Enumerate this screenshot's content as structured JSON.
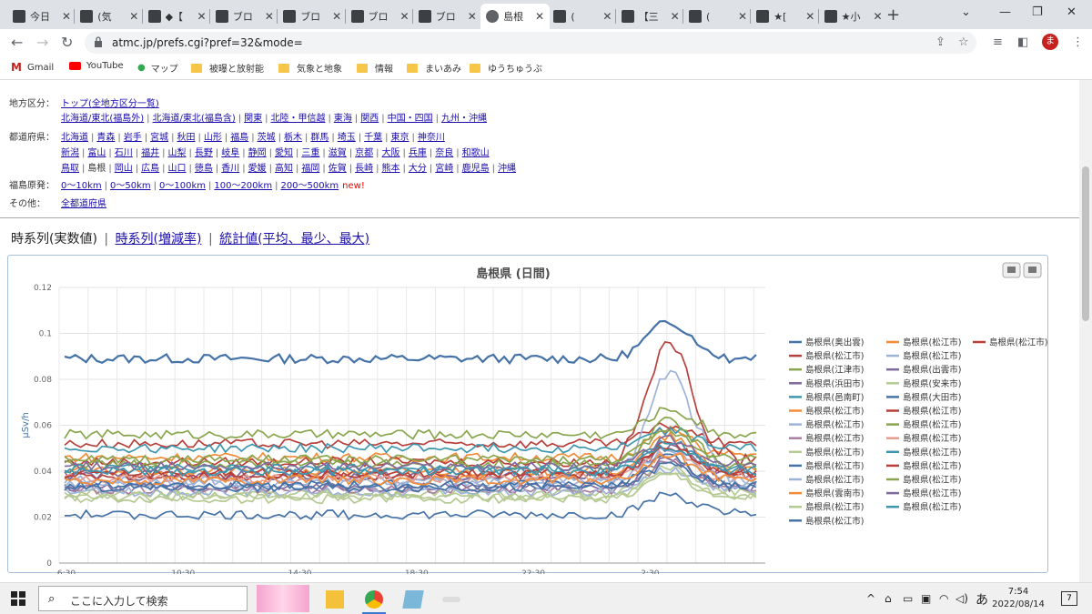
{
  "tabs": [
    {
      "title": "今日",
      "active": false
    },
    {
      "title": "(気",
      "active": false
    },
    {
      "title": "◆【",
      "active": false
    },
    {
      "title": "ブロ",
      "active": false
    },
    {
      "title": "ブロ",
      "active": false
    },
    {
      "title": "ブロ",
      "active": false
    },
    {
      "title": "ブロ",
      "active": false
    },
    {
      "title": "島根",
      "active": true
    },
    {
      "title": "(",
      "active": false
    },
    {
      "title": "【三",
      "active": false
    },
    {
      "title": "(",
      "active": false
    },
    {
      "title": "★[",
      "active": false
    },
    {
      "title": "★小",
      "active": false
    }
  ],
  "toolbar": {
    "url": "atmc.jp/prefs.cgi?pref=32&mode=",
    "avatar": "ま"
  },
  "bookmarks": [
    "Gmail",
    "YouTube",
    "マップ",
    "被曝と放射能",
    "気象と地象",
    "情報",
    "まいあみ",
    "ゆうちゅうぶ"
  ],
  "nav": {
    "region_label": "地方区分：",
    "region_top": "トップ(全地方区分一覧)",
    "regions": [
      "北海道/東北(福島外)",
      "北海道/東北(福島含)",
      "関東",
      "北陸・甲信越",
      "東海",
      "関西",
      "中国・四国",
      "九州・沖縄"
    ],
    "pref_label": "都道府県：",
    "prefs_row1": [
      "北海道",
      "青森",
      "岩手",
      "宮城",
      "秋田",
      "山形",
      "福島",
      "茨城",
      "栃木",
      "群馬",
      "埼玉",
      "千葉",
      "東京",
      "神奈川"
    ],
    "prefs_row2": [
      "新潟",
      "富山",
      "石川",
      "福井",
      "山梨",
      "長野",
      "岐阜",
      "静岡",
      "愛知",
      "三重",
      "滋賀",
      "京都",
      "大阪",
      "兵庫",
      "奈良",
      "和歌山"
    ],
    "prefs_row3": [
      "鳥取",
      "島根",
      "岡山",
      "広島",
      "山口",
      "徳島",
      "香川",
      "愛媛",
      "高知",
      "福岡",
      "佐賀",
      "長崎",
      "熊本",
      "大分",
      "宮崎",
      "鹿児島",
      "沖縄"
    ],
    "current_pref": "島根",
    "fukushima_label": "福島原発：",
    "distances": [
      "0〜10km",
      "0〜50km",
      "0〜100km",
      "100〜200km",
      "200〜500km"
    ],
    "new_flag": "new!",
    "other_label": "その他：",
    "other_link": "全都道府県"
  },
  "view_tabs": {
    "current": "時系列(実数値)",
    "link1": "時系列(増減率)",
    "link2": "統計値(平均、最少、最大)",
    "sep": "|"
  },
  "chart_data": {
    "type": "line",
    "title": "島根県 (日間)",
    "ylabel": "μSv/h",
    "ylim": [
      0,
      0.12
    ],
    "yticks": [
      "0",
      "0.02",
      "0.04",
      "0.06",
      "0.08",
      "0.1",
      "0.12"
    ],
    "x_tick_labels": [
      "6:30",
      "10:30",
      "14:30",
      "18:30",
      "22:30",
      "2:30"
    ],
    "grid": true,
    "legend_position": "right",
    "series": [
      {
        "name": "島根県(奥出雲)",
        "color": "#4572a7",
        "base": 0.089,
        "peak": 0.105
      },
      {
        "name": "島根県(松江市)",
        "color": "#f28c38",
        "base": 0.046,
        "peak": 0.058
      },
      {
        "name": "島根県(松江市)",
        "color": "#b8403b",
        "base": 0.044,
        "peak": 0.096
      },
      {
        "name": "島根県(松江市)",
        "color": "#b8403b",
        "base": 0.052,
        "peak": 0.06
      },
      {
        "name": "島根県(松江市)",
        "color": "#9eb2d8",
        "base": 0.036,
        "peak": 0.083
      },
      {
        "name": "島根県(江津市)",
        "color": "#89a54e",
        "base": 0.056,
        "peak": 0.067
      },
      {
        "name": "島根県(出雲市)",
        "color": "#80699b",
        "base": 0.038,
        "peak": 0.05
      },
      {
        "name": "島根県(浜田市)",
        "color": "#80699b",
        "base": 0.033,
        "peak": 0.045
      },
      {
        "name": "島根県(安来市)",
        "color": "#b5ca92",
        "base": 0.03,
        "peak": 0.042
      },
      {
        "name": "島根県(邑南町)",
        "color": "#3d96ae",
        "base": 0.05,
        "peak": 0.058
      },
      {
        "name": "島根県(大田市)",
        "color": "#4572a7",
        "base": 0.021,
        "peak": 0.03
      },
      {
        "name": "島根県(松江市)",
        "color": "#f28c38",
        "base": 0.04,
        "peak": 0.055
      },
      {
        "name": "島根県(松江市)",
        "color": "#b8403b",
        "base": 0.038,
        "peak": 0.052
      },
      {
        "name": "島根県(松江市)",
        "color": "#9eb2d8",
        "base": 0.035,
        "peak": 0.05
      },
      {
        "name": "島根県(松江市)",
        "color": "#89a54e",
        "base": 0.043,
        "peak": 0.062
      },
      {
        "name": "島根県(松江市)",
        "color": "#aa7ea0",
        "base": 0.032,
        "peak": 0.044
      },
      {
        "name": "島根県(松江市)",
        "color": "#e89c8d",
        "base": 0.037,
        "peak": 0.048
      },
      {
        "name": "島根県(松江市)",
        "color": "#b5ca92",
        "base": 0.028,
        "peak": 0.038
      },
      {
        "name": "島根県(松江市)",
        "color": "#3d96ae",
        "base": 0.041,
        "peak": 0.053
      },
      {
        "name": "島根県(松江市)",
        "color": "#4572a7",
        "base": 0.034,
        "peak": 0.046
      },
      {
        "name": "島根県(松江市)",
        "color": "#b8403b",
        "base": 0.039,
        "peak": 0.05
      },
      {
        "name": "島根県(松江市)",
        "color": "#9eb2d8",
        "base": 0.031,
        "peak": 0.041
      },
      {
        "name": "島根県(松江市)",
        "color": "#89a54e",
        "base": 0.045,
        "peak": 0.057
      },
      {
        "name": "島根県(雲南市)",
        "color": "#f28c38",
        "base": 0.036,
        "peak": 0.047
      },
      {
        "name": "島根県(松江市)",
        "color": "#80699b",
        "base": 0.042,
        "peak": 0.054
      },
      {
        "name": "島根県(松江市)",
        "color": "#b5ca92",
        "base": 0.029,
        "peak": 0.039
      },
      {
        "name": "島根県(松江市)",
        "color": "#3d96ae",
        "base": 0.04,
        "peak": 0.051
      },
      {
        "name": "島根県(松江市)",
        "color": "#4572a7",
        "base": 0.033,
        "peak": 0.043
      }
    ]
  },
  "taskbar": {
    "search_placeholder": "ここに入力して検索",
    "time": "7:54",
    "date": "2022/08/14",
    "ime": "あ",
    "notif": "7"
  }
}
